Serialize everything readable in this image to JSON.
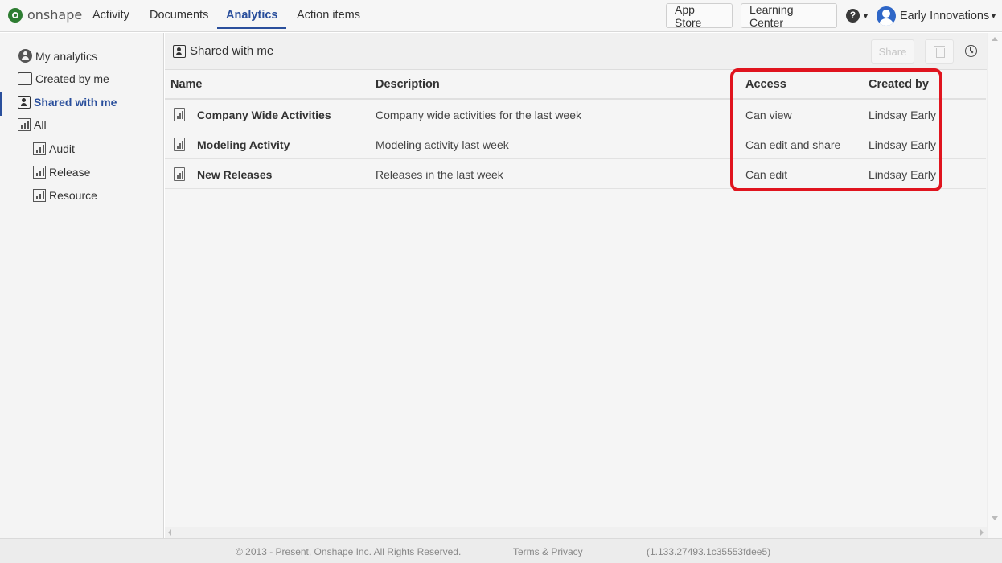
{
  "topnav": {
    "brand": "onshape",
    "links": [
      "Activity",
      "Documents",
      "Analytics",
      "Action items"
    ],
    "app_store": "App Store",
    "learning_center": "Learning Center",
    "help_symbol": "?",
    "company": "Early Innovations"
  },
  "sidebar": {
    "items": [
      {
        "label": "My analytics",
        "icon": "user-circle-icon"
      },
      {
        "label": "Created by me",
        "icon": "document-icon"
      },
      {
        "label": "Shared with me",
        "icon": "shared-icon"
      },
      {
        "label": "All",
        "icon": "report-icon"
      },
      {
        "label": "Audit",
        "icon": "report-icon"
      },
      {
        "label": "Release",
        "icon": "report-icon"
      },
      {
        "label": "Resource",
        "icon": "report-icon"
      }
    ]
  },
  "main": {
    "title": "Shared with me",
    "share_label": "Share",
    "columns": [
      "Name",
      "Description",
      "Access",
      "Created by"
    ],
    "rows": [
      {
        "name": "Company Wide Activities",
        "description": "Company wide activities for the last week",
        "access": "Can view",
        "created_by": "Lindsay Early"
      },
      {
        "name": "Modeling Activity",
        "description": "Modeling activity last week",
        "access": "Can edit and share",
        "created_by": "Lindsay Early"
      },
      {
        "name": "New Releases",
        "description": "Releases in the last week",
        "access": "Can edit",
        "created_by": "Lindsay Early"
      }
    ]
  },
  "footer": {
    "copyright": "© 2013 - Present, Onshape Inc. All Rights Reserved.",
    "terms": "Terms & Privacy",
    "version": "(1.133.27493.1c35553fdee5)"
  },
  "colors": {
    "accent": "#2a4f9c",
    "highlight": "#e0141e",
    "brand_green": "#2e7d32"
  }
}
